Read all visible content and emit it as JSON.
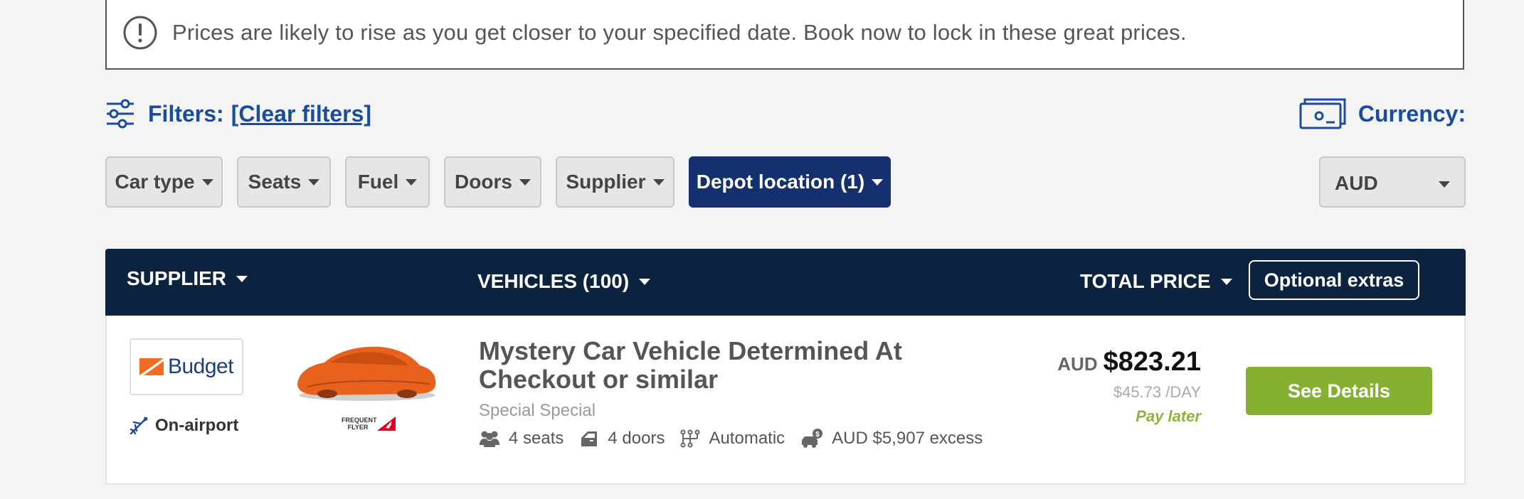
{
  "notice": {
    "text": "Prices are likely to rise as you get closer to your specified date. Book now to lock in these great prices.",
    "icon": "exclamation-circle-icon"
  },
  "filters": {
    "label": "Filters:",
    "clear_label": "[Clear filters]",
    "chips": [
      {
        "label": "Car type",
        "active": false
      },
      {
        "label": "Seats",
        "active": false
      },
      {
        "label": "Fuel",
        "active": false
      },
      {
        "label": "Doors",
        "active": false
      },
      {
        "label": "Supplier",
        "active": false
      },
      {
        "label": "Depot location (1)",
        "active": true
      }
    ]
  },
  "currency": {
    "label": "Currency:",
    "selected": "AUD"
  },
  "results_header": {
    "supplier": "SUPPLIER",
    "vehicles": "VEHICLES (100)",
    "total_price": "TOTAL PRICE",
    "optional_extras": "Optional extras"
  },
  "result": {
    "supplier_name": "Budget",
    "location_type": "On-airport",
    "frequent_flyer_text": "FREQUENT FLYER",
    "title": "Mystery Car Vehicle Determined At Checkout or similar",
    "class": "Special Special",
    "specs": {
      "seats": "4 seats",
      "doors": "4 doors",
      "transmission": "Automatic",
      "excess": "AUD $5,907 excess"
    },
    "price_currency": "AUD",
    "price_total": "$823.21",
    "price_per_day": "$45.73 /DAY",
    "payment": "Pay later",
    "cta": "See Details"
  },
  "colors": {
    "brand_blue": "#1b4c9c",
    "header_navy": "#0c2340",
    "active_chip": "#15306e",
    "cta_green": "#86b031",
    "budget_orange": "#f26b21"
  }
}
